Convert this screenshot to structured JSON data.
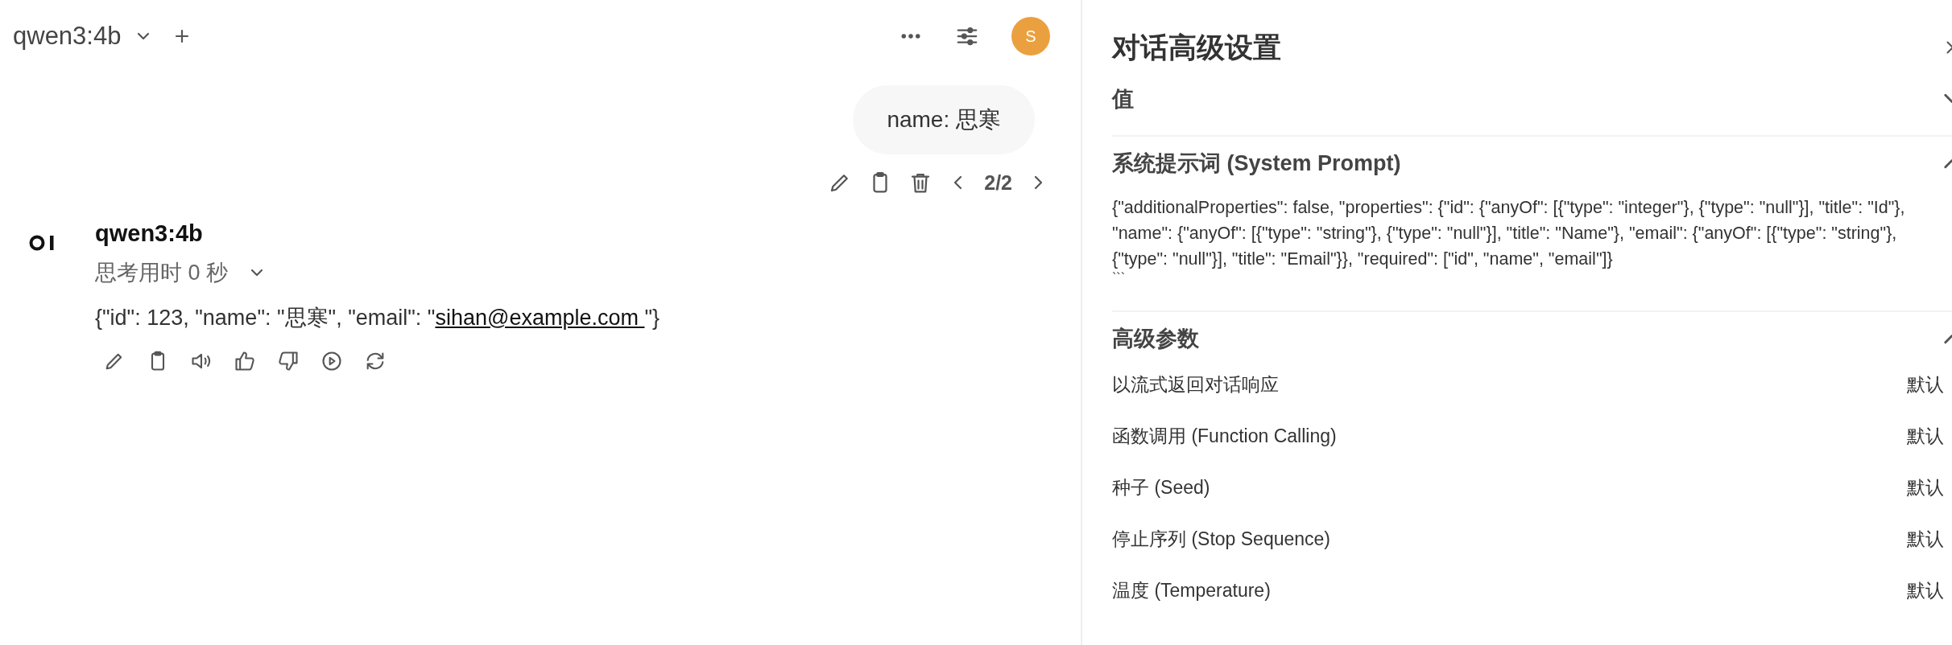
{
  "header": {
    "model": "qwen3:4b",
    "avatar": "S"
  },
  "user_message": {
    "text": "name: 思寒",
    "pager": "2/2"
  },
  "assistant_message": {
    "model": "qwen3:4b",
    "thinking": "思考用时 0 秒",
    "thinking_expanded": false,
    "response_start": "{\"id\": 123, \"name\": \"思寒\", \"email\": \"",
    "link": "sihan@example.com ",
    "response_end": "\"}"
  },
  "settings": {
    "title": "对话高级设置",
    "sections": [
      {
        "title": "值",
        "expanded": false
      },
      {
        "title": "系统提示词 (System Prompt)",
        "expanded": true,
        "kind": "text",
        "body": "{\"additionalProperties\": false, \"properties\": {\"id\": {\"anyOf\": [{\"type\": \"integer\"}, {\"type\": \"null\"}], \"title\": \"Id\"}, \"name\": {\"anyOf\": [{\"type\": \"string\"}, {\"type\": \"null\"}], \"title\": \"Name\"}, \"email\": {\"anyOf\": [{\"type\": \"string\"}, {\"type\": \"null\"}], \"title\": \"Email\"}}, \"required\": [\"id\", \"name\", \"email\"]}",
        "body_tail": "```"
      },
      {
        "title": "高级参数",
        "expanded": true,
        "kind": "params",
        "params": [
          {
            "label": "以流式返回对话响应",
            "value": "默认"
          },
          {
            "label": "函数调用 (Function Calling)",
            "value": "默认"
          },
          {
            "label": "种子 (Seed)",
            "value": "默认"
          },
          {
            "label": "停止序列 (Stop Sequence)",
            "value": "默认"
          },
          {
            "label": "温度 (Temperature)",
            "value": "默认"
          }
        ]
      }
    ]
  }
}
